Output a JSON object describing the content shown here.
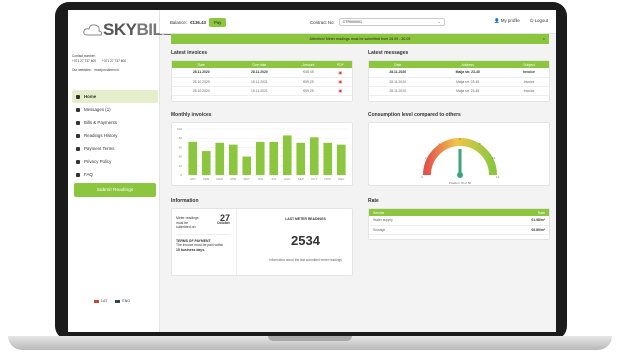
{
  "app": {
    "logo_prefix": "",
    "logo_main": "SKY",
    "logo_suffix": "BILL",
    "contact_label": "Contact number:",
    "phone1": "+371 27 737 600",
    "phone2": "+371 27 737 600",
    "website_label": "Our websites:",
    "website": "maxijon.skbmn.lv"
  },
  "sidebar": {
    "items": [
      {
        "label": "Home",
        "icon": "home-icon"
      },
      {
        "label": "Messages (1)",
        "icon": "mail-icon"
      },
      {
        "label": "Bills & Payments",
        "icon": "wallet-icon"
      },
      {
        "label": "Readings History",
        "icon": "chart-icon"
      },
      {
        "label": "Payment Terms",
        "icon": "document-icon"
      },
      {
        "label": "Privacy Policy",
        "icon": "shield-icon"
      },
      {
        "label": "FAQ",
        "icon": "question-icon"
      }
    ],
    "submit_label": "Submit Readings",
    "lang1": "LAT",
    "lang2": "ENG"
  },
  "header": {
    "balance_label": "Balance:",
    "balance_value": "€136.43",
    "pay_label": "Pay",
    "contract_label": "Contract No:",
    "contract_value": "CTR000001",
    "profile_label": "My profile",
    "logout_label": "Logout"
  },
  "alert": {
    "text": "Attention! Meter readings must be submitted from 26.09 - 30.09",
    "close": "×"
  },
  "invoices": {
    "title": "Latest invoices",
    "headers": [
      "Date",
      "Due date",
      "Amount",
      "PDF"
    ],
    "rows": [
      {
        "date": "28.11.2020",
        "due": "28.11.2020",
        "amount": "€45,45"
      },
      {
        "date": "28.10.2020",
        "due": "15.11.2021",
        "amount": "€59,25"
      },
      {
        "date": "28.10.2020",
        "due": "15.11.2021",
        "amount": "€59,25"
      }
    ]
  },
  "messages": {
    "title": "Latest messages",
    "headers": [
      "Date",
      "Address",
      "Subject"
    ],
    "rows": [
      {
        "date": "28.11.2020",
        "address": "Maija str. 23-45",
        "subject": "Invoice"
      },
      {
        "date": "28.11.2020",
        "address": "Maija str. 23-45",
        "subject": "Invoice"
      },
      {
        "date": "28.11.2020",
        "address": "Maija str. 23-45",
        "subject": "Invoice"
      }
    ]
  },
  "monthly": {
    "title": "Monthly invoices"
  },
  "consumption": {
    "title": "Consumption level compared to others",
    "caption": "Position 70 of 50",
    "ticks": [
      "0",
      "2",
      "4",
      "6",
      "8",
      "10",
      "12"
    ]
  },
  "information": {
    "title": "Information",
    "meter_label": "Meter readings must be submitted on:",
    "meter_day": "27",
    "meter_month": "October",
    "terms_title": "TERMS OF PAYMENT",
    "terms_text": "The invoice must be paid within",
    "terms_days": "15 business days.",
    "last_title": "LAST METER READINGS",
    "last_value": "2534",
    "last_caption": "Information about the last submitted meter readings"
  },
  "rate": {
    "title": "Rate",
    "headers": [
      "Service",
      "Rate"
    ],
    "rows": [
      {
        "service": "Water supply",
        "rate": "€1.98/m³"
      },
      {
        "service": "Sewage",
        "rate": "€0.89/m³"
      }
    ]
  },
  "chart_data": {
    "type": "bar",
    "title": "Monthly invoices",
    "categories": [
      "JAN",
      "FEB",
      "MAR",
      "APR",
      "MAY",
      "JUN",
      "JUL",
      "AUG",
      "SEP",
      "OCT",
      "NOV",
      "DEC"
    ],
    "values": [
      72,
      52,
      70,
      66,
      40,
      72,
      72,
      86,
      70,
      82,
      70,
      66
    ],
    "ylim": [
      0,
      100
    ],
    "yticks": [
      "100",
      "80",
      "60",
      "40",
      "20",
      "0"
    ],
    "bar_color": "#8cc63f"
  }
}
